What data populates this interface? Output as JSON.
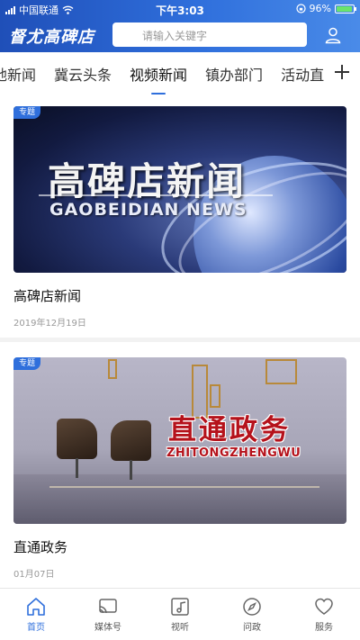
{
  "status_bar": {
    "carrier": "中国联通",
    "time": "下午3:03",
    "battery": "96%",
    "battery_level": 0.96
  },
  "header": {
    "logo": "督尤高碑店",
    "search_placeholder": "请输入关键字"
  },
  "tabs": {
    "items": [
      {
        "label": "地新闻"
      },
      {
        "label": "冀云头条"
      },
      {
        "label": "视频新闻",
        "active": true
      },
      {
        "label": "镇办部门"
      },
      {
        "label": "活动直"
      }
    ]
  },
  "feed": [
    {
      "badge": "专题",
      "thumb_title": "高碑店新闻",
      "thumb_subtitle": "GAOBEIDIAN NEWS",
      "title": "高碑店新闻",
      "date": "2019年12月19日"
    },
    {
      "badge": "专题",
      "thumb_title": "直通政务",
      "thumb_subtitle": "ZHITONGZHENGWU",
      "title": "直通政务",
      "date": "01月07日"
    }
  ],
  "bottom_nav": [
    {
      "label": "首页",
      "icon": "home-icon",
      "active": true
    },
    {
      "label": "媒体号",
      "icon": "cast-icon"
    },
    {
      "label": "视听",
      "icon": "music-image-icon"
    },
    {
      "label": "问政",
      "icon": "compass-icon"
    },
    {
      "label": "服务",
      "icon": "heart-icon"
    }
  ],
  "colors": {
    "accent": "#2f6fdc",
    "header_start": "#1f4fb8",
    "header_end": "#4a8be8"
  }
}
